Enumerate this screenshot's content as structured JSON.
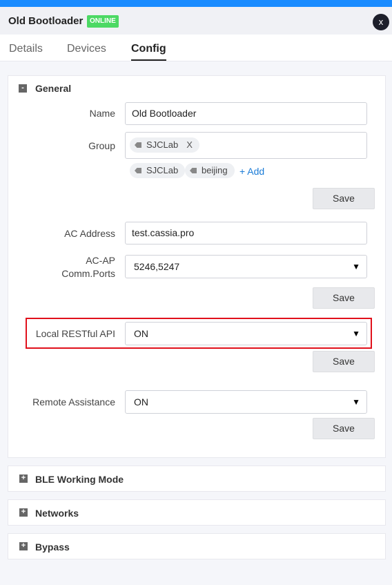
{
  "header": {
    "title": "Old Bootloader",
    "status": "ONLINE",
    "close_label": "x",
    "close_icon": "close-icon",
    "accent_color": "#1a8cff",
    "status_color": "#4cd964"
  },
  "tabs": [
    {
      "label": "Details",
      "active": false
    },
    {
      "label": "Devices",
      "active": false
    },
    {
      "label": "Config",
      "active": true
    }
  ],
  "general": {
    "title": "General",
    "toggle": "-",
    "name": {
      "label": "Name",
      "value": "Old Bootloader"
    },
    "group": {
      "label": "Group",
      "selected_tags": [
        {
          "label": "SJCLab",
          "remove": "X"
        }
      ],
      "available_tags": [
        {
          "label": "SJCLab"
        },
        {
          "label": "beijing"
        }
      ],
      "add_label": "+ Add"
    },
    "save_group": "Save",
    "ac_address": {
      "label": "AC Address",
      "value": "test.cassia.pro"
    },
    "ac_ports": {
      "label_line1": "AC-AP",
      "label_line2": "Comm.Ports",
      "value": "5246,5247"
    },
    "save_ac": "Save",
    "restful": {
      "label": "Local RESTful API",
      "value": "ON"
    },
    "save_restful": "Save",
    "remote": {
      "label": "Remote Assistance",
      "value": "ON"
    },
    "save_remote": "Save"
  },
  "sections": [
    {
      "title": "BLE Working Mode",
      "toggle": "+"
    },
    {
      "title": "Networks",
      "toggle": "+"
    },
    {
      "title": "Bypass",
      "toggle": "+"
    }
  ],
  "caret": "▼"
}
